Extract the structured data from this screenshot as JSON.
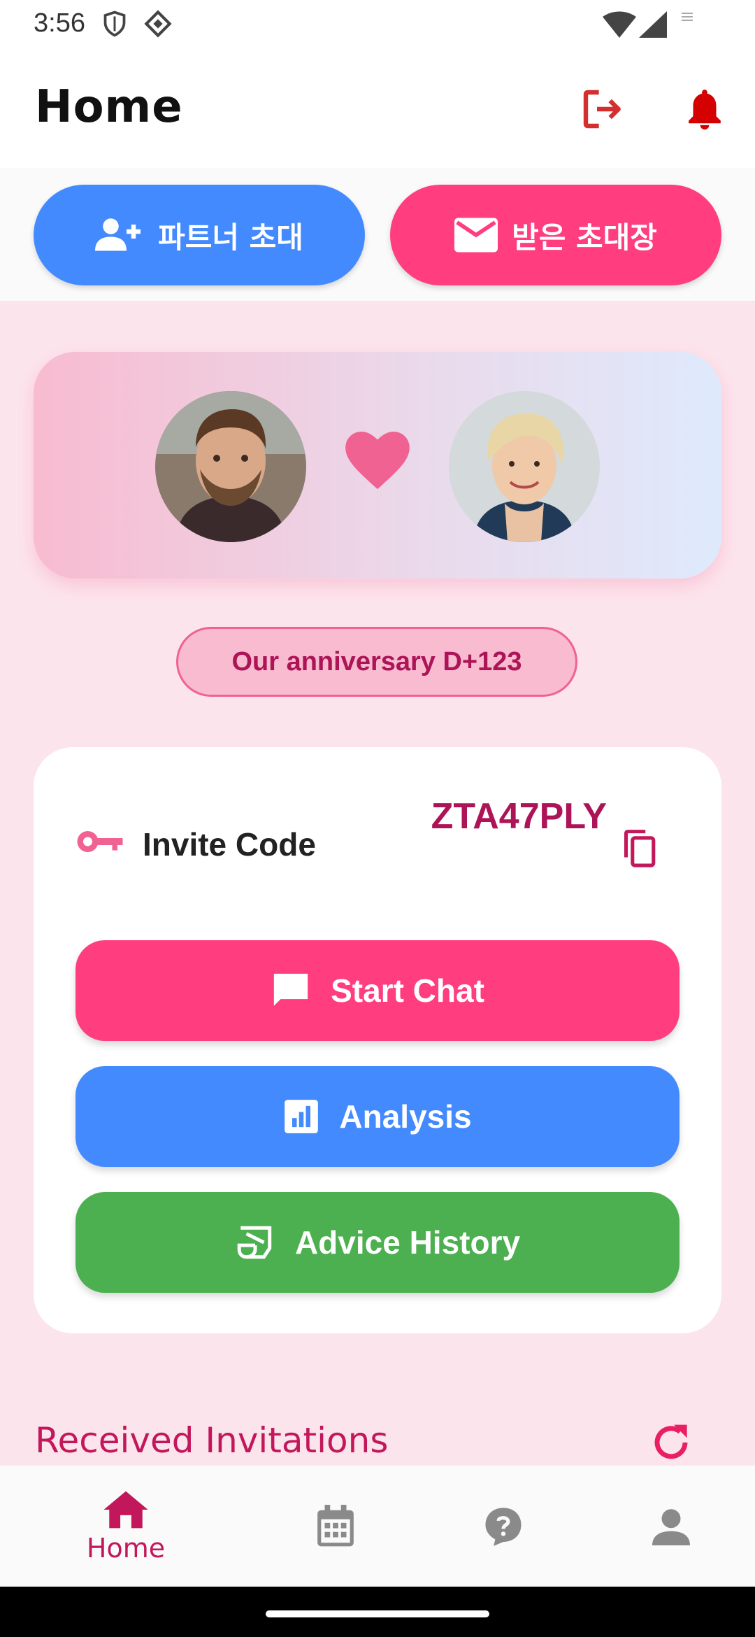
{
  "status_bar": {
    "time": "3:56"
  },
  "app_bar": {
    "title": "Home"
  },
  "top_actions": {
    "invite_partner_label": "파트너 초대",
    "received_invites_label": "받은 초대장"
  },
  "anniversary": {
    "text": "Our anniversary D+123"
  },
  "invite_card": {
    "label": "Invite Code",
    "code": "ZTA47PLY"
  },
  "buttons": {
    "start_chat": "Start Chat",
    "analysis": "Analysis",
    "advice_history": "Advice History"
  },
  "received_invitations": {
    "title": "Received Invitations"
  },
  "bottom_nav": {
    "items": [
      {
        "label": "Home",
        "icon": "home-icon",
        "active": true
      },
      {
        "label": "",
        "icon": "calendar-icon",
        "active": false
      },
      {
        "label": "",
        "icon": "help-bubble-icon",
        "active": false
      },
      {
        "label": "",
        "icon": "person-icon",
        "active": false
      }
    ]
  },
  "colors": {
    "brand_pink": "#ff3d7f",
    "brand_blue": "#448aff",
    "brand_green": "#4caf50",
    "accent_dark_pink": "#ad1457",
    "alert_red": "#d50000"
  }
}
